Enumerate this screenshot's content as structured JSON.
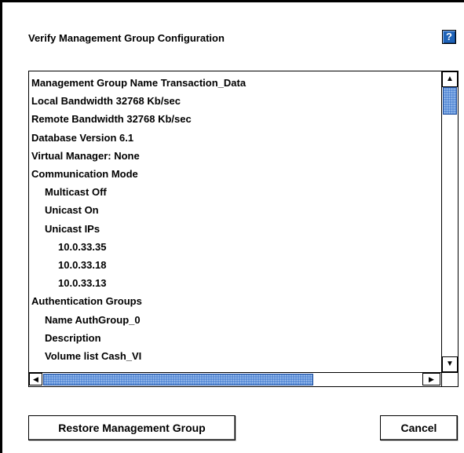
{
  "dialog": {
    "title": "Verify Management Group Configuration",
    "help_icon_glyph": "?"
  },
  "config_list": {
    "items": [
      {
        "text": "Management Group Name Transaction_Data",
        "indent": 0
      },
      {
        "text": "Local Bandwidth 32768 Kb/sec",
        "indent": 0
      },
      {
        "text": "Remote Bandwidth 32768 Kb/sec",
        "indent": 0
      },
      {
        "text": "Database Version 6.1",
        "indent": 0
      },
      {
        "text": "Virtual Manager: None",
        "indent": 0
      },
      {
        "text": "Communication Mode",
        "indent": 0
      },
      {
        "text": "Multicast Off",
        "indent": 1
      },
      {
        "text": "Unicast On",
        "indent": 1
      },
      {
        "text": "Unicast IPs",
        "indent": 1
      },
      {
        "text": "10.0.33.35",
        "indent": 2
      },
      {
        "text": "10.0.33.18",
        "indent": 2
      },
      {
        "text": "10.0.33.13",
        "indent": 2
      },
      {
        "text": "Authentication Groups",
        "indent": 0
      },
      {
        "text": "Name AuthGroup_0",
        "indent": 1
      },
      {
        "text": "Description",
        "indent": 1
      },
      {
        "text": "Volume list Cash_VI",
        "indent": 1
      }
    ]
  },
  "scrollbars": {
    "up_arrow": "▲",
    "down_arrow": "▼",
    "left_arrow": "◀",
    "right_arrow": "▶",
    "thumb_color": "#4a7fd0"
  },
  "buttons": {
    "restore_label": "Restore Management Group",
    "cancel_label": "Cancel"
  },
  "colors": {
    "accent": "#1f63b8"
  }
}
